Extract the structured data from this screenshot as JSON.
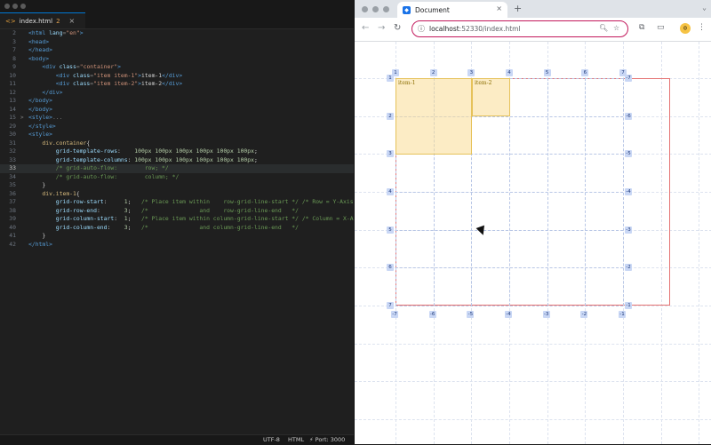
{
  "editor": {
    "tab": {
      "icon": "<>",
      "filename": "index.html",
      "modified": "2",
      "close": "×"
    },
    "lines": [
      {
        "n": "2",
        "fold": "",
        "src": [
          [
            "t",
            "<html "
          ],
          [
            "a",
            "lang"
          ],
          [
            "p",
            "="
          ],
          [
            "s",
            "\"en\""
          ],
          [
            "t",
            ">"
          ]
        ]
      },
      {
        "n": "3",
        "fold": "",
        "src": [
          [
            "t",
            "<head>"
          ]
        ]
      },
      {
        "n": "7",
        "fold": "",
        "src": [
          [
            "t",
            "</head>"
          ]
        ]
      },
      {
        "n": "8",
        "fold": "",
        "src": [
          [
            "t",
            "<body>"
          ]
        ]
      },
      {
        "n": "9",
        "fold": "",
        "src": [
          [
            "w",
            "    "
          ],
          [
            "t",
            "<div "
          ],
          [
            "a",
            "class"
          ],
          [
            "p",
            "="
          ],
          [
            "s",
            "\"container\""
          ],
          [
            "t",
            ">"
          ]
        ]
      },
      {
        "n": "10",
        "fold": "",
        "src": [
          [
            "w",
            "        "
          ],
          [
            "t",
            "<div "
          ],
          [
            "a",
            "class"
          ],
          [
            "p",
            "="
          ],
          [
            "s",
            "\"item item-1\""
          ],
          [
            "t",
            ">"
          ],
          [
            "w",
            "item-1"
          ],
          [
            "t",
            "</div>"
          ]
        ]
      },
      {
        "n": "11",
        "fold": "",
        "src": [
          [
            "w",
            "        "
          ],
          [
            "t",
            "<div "
          ],
          [
            "a",
            "class"
          ],
          [
            "p",
            "="
          ],
          [
            "s",
            "\"item item-2\""
          ],
          [
            "t",
            ">"
          ],
          [
            "w",
            "item-2"
          ],
          [
            "t",
            "</div>"
          ]
        ]
      },
      {
        "n": "12",
        "fold": "",
        "src": [
          [
            "w",
            "    "
          ],
          [
            "t",
            "</div>"
          ]
        ]
      },
      {
        "n": "13",
        "fold": "",
        "src": [
          [
            "t",
            "</body>"
          ]
        ]
      },
      {
        "n": "14",
        "fold": "",
        "src": [
          [
            "t",
            "</body>"
          ]
        ]
      },
      {
        "n": "15",
        "fold": ">",
        "src": [
          [
            "t",
            "<style>"
          ],
          [
            "p",
            "..."
          ]
        ]
      },
      {
        "n": "29",
        "fold": "",
        "src": [
          [
            "t",
            "</style>"
          ]
        ]
      },
      {
        "n": "30",
        "fold": "",
        "src": [
          [
            "t",
            "<style>"
          ]
        ]
      },
      {
        "n": "31",
        "fold": "",
        "src": [
          [
            "w",
            "    "
          ],
          [
            "sel",
            "div.container"
          ],
          [
            "w",
            "{"
          ]
        ]
      },
      {
        "n": "32",
        "fold": "",
        "src": [
          [
            "w",
            "        "
          ],
          [
            "k",
            "grid-template-rows"
          ],
          [
            "w",
            ":    "
          ],
          [
            "n",
            "100px 100px 100px 100px 100px 100px"
          ],
          [
            "w",
            ";"
          ]
        ]
      },
      {
        "n": "33",
        "fold": "",
        "src": [
          [
            "w",
            "        "
          ],
          [
            "k",
            "grid-template-columns"
          ],
          [
            "w",
            ": "
          ],
          [
            "n",
            "100px 100px 100px 100px 100px 100px"
          ],
          [
            "w",
            ";"
          ]
        ]
      },
      {
        "n": "33",
        "fold": "",
        "active": true,
        "src": [
          [
            "w",
            "        "
          ],
          [
            "c",
            "/* grid-auto-flow:        row; */"
          ]
        ]
      },
      {
        "n": "34",
        "fold": "",
        "src": [
          [
            "w",
            "        "
          ],
          [
            "c",
            "/* grid-auto-flow:        column; */"
          ]
        ]
      },
      {
        "n": "35",
        "fold": "",
        "src": [
          [
            "w",
            "    }"
          ]
        ]
      },
      {
        "n": "36",
        "fold": "",
        "src": [
          [
            "w",
            "    "
          ],
          [
            "sel",
            "div.item-1"
          ],
          [
            "w",
            "{"
          ]
        ]
      },
      {
        "n": "37",
        "fold": "",
        "src": [
          [
            "w",
            "        "
          ],
          [
            "k",
            "grid-row-start"
          ],
          [
            "w",
            ":     "
          ],
          [
            "n",
            "1"
          ],
          [
            "w",
            ";   "
          ],
          [
            "c",
            "/* Place item within    row-grid-line-start */ /* Row = Y-Axis"
          ]
        ]
      },
      {
        "n": "38",
        "fold": "",
        "src": [
          [
            "w",
            "        "
          ],
          [
            "k",
            "grid-row-end"
          ],
          [
            "w",
            ":       "
          ],
          [
            "n",
            "3"
          ],
          [
            "w",
            ";   "
          ],
          [
            "c",
            "/*               and    row-grid-line-end   */"
          ]
        ]
      },
      {
        "n": "39",
        "fold": "",
        "src": [
          [
            "w",
            "        "
          ],
          [
            "k",
            "grid-column-start"
          ],
          [
            "w",
            ":  "
          ],
          [
            "n",
            "1"
          ],
          [
            "w",
            ";   "
          ],
          [
            "c",
            "/* Place item within column-grid-line-start */ /* Column = X-A"
          ]
        ]
      },
      {
        "n": "40",
        "fold": "",
        "src": [
          [
            "w",
            "        "
          ],
          [
            "k",
            "grid-column-end"
          ],
          [
            "w",
            ":    "
          ],
          [
            "n",
            "3"
          ],
          [
            "w",
            ";   "
          ],
          [
            "c",
            "/*               and column-grid-line-end   */"
          ]
        ]
      },
      {
        "n": "41",
        "fold": "",
        "src": [
          [
            "w",
            "    }"
          ]
        ]
      },
      {
        "n": "42",
        "fold": "",
        "src": [
          [
            "t",
            "</html>"
          ]
        ]
      }
    ],
    "status": {
      "encoding": "UTF-8",
      "language": "HTML",
      "port": "⚡ Port: 3000"
    }
  },
  "browser": {
    "tab_title": "Document",
    "tab_close": "×",
    "new_tab": "+",
    "url_host": "localhost",
    "url_rest": ":52330/index.html",
    "nav": {
      "back": "←",
      "forward": "→",
      "reload": "↻"
    },
    "item1_label": "item-1",
    "item2_label": "item-2",
    "top_badges": [
      "1",
      "2",
      "3",
      "4",
      "5",
      "6",
      "7"
    ],
    "left_badges": [
      "1",
      "2",
      "3",
      "4",
      "5",
      "6",
      "7"
    ],
    "bottom_badges": [
      "-7",
      "-6",
      "-5",
      "-4",
      "-3",
      "-2",
      "-1"
    ],
    "right_badges": [
      "-7",
      "-6",
      "-5",
      "-4",
      "-3",
      "-2",
      "-1"
    ]
  },
  "colors": {
    "accent": "#0078d4",
    "omnibox_border": "#c2185b",
    "container_border": "#e57373",
    "item_fill": "#fadc96"
  }
}
